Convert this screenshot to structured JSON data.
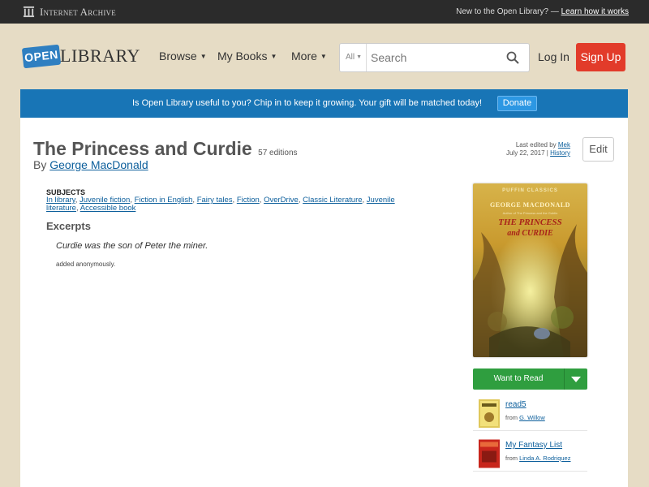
{
  "topbar": {
    "brand": "Internet Archive",
    "new_text": "New to the Open Library? —",
    "learn_link": "Learn how it works"
  },
  "header": {
    "logo_open": "OPEN",
    "logo_library": "LIBRARY",
    "nav": [
      "Browse",
      "My Books",
      "More"
    ],
    "search_scope": "All",
    "search_placeholder": "Search",
    "login": "Log In",
    "signup": "Sign Up"
  },
  "donate": {
    "message": "Is Open Library useful to you? Chip in to keep it growing. Your gift will be matched today!",
    "button": "Donate"
  },
  "book": {
    "title": "The Princess and Curdie",
    "editions": "57 editions",
    "by": "By",
    "author": "George MacDonald",
    "last_edited_prefix": "Last edited by",
    "last_edited_user": "Mek",
    "last_edited_date": "July 22, 2017",
    "history_link": "History",
    "edit_button": "Edit"
  },
  "subjects": {
    "label": "SUBJECTS",
    "items": [
      "In library",
      "Juvenile fiction",
      "Fiction in English",
      "Fairy tales",
      "Fiction",
      "OverDrive",
      "Classic Literature",
      "Juvenile literature",
      "Accessible book"
    ]
  },
  "excerpts": {
    "heading": "Excerpts",
    "quote": "Curdie was the son of Peter the miner.",
    "credit": "added anonymously."
  },
  "cover": {
    "series": "PUFFIN CLASSICS",
    "author": "GEORGE MACDONALD",
    "subtitle_line": "Author of The Princess and the Goblin",
    "title_line1": "THE PRINCESS",
    "title_line2": "and CURDIE"
  },
  "sidebar": {
    "want_to_read": "Want to Read",
    "lists": [
      {
        "name": "read5",
        "from_label": "from",
        "owner": "G. Willow"
      },
      {
        "name": "My Fantasy List",
        "from_label": "from",
        "owner": "Linda A. Rodriquez"
      }
    ]
  }
}
